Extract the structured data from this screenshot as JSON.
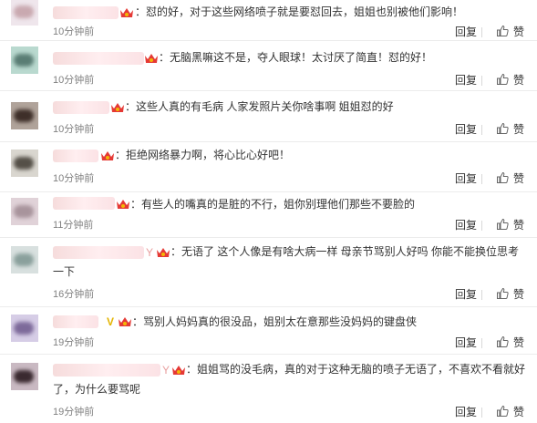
{
  "comments": [
    {
      "name_tail": "",
      "text": "：怼的好，对于这些网络喷子就是要怼回去，姐姐也别被他们影响！",
      "text2": "",
      "time": "10分钟前",
      "reply": "回复",
      "like": "赞"
    },
    {
      "name_tail": "",
      "text": "：无脑黑嘛这不是，夺人眼球！太讨厌了简直！怼的好！",
      "text2": "",
      "time": "10分钟前",
      "reply": "回复",
      "like": "赞"
    },
    {
      "name_tail": "",
      "text": "：这些人真的有毛病 人家发照片关你啥事啊 姐姐怼的好",
      "text2": "",
      "time": "10分钟前",
      "reply": "回复",
      "like": "赞"
    },
    {
      "name_tail": "",
      "text": "：拒绝网络暴力啊，将心比心好吧！",
      "text2": "",
      "time": "10分钟前",
      "reply": "回复",
      "like": "赞"
    },
    {
      "name_tail": "",
      "text": "：有些人的嘴真的是脏的不行，姐你别理他们那些不要脸的",
      "text2": "",
      "time": "11分钟前",
      "reply": "回复",
      "like": "赞"
    },
    {
      "name_tail": "Y",
      "text": "：无语了 这个人像是有啥大病一样 母亲节骂别人好吗 你能不能换位思考",
      "text2": "一下",
      "time": "16分钟前",
      "reply": "回复",
      "like": "赞"
    },
    {
      "name_tail": "V",
      "text": "：骂别人妈妈真的很没品，姐别太在意那些没妈妈的键盘侠",
      "text2": "",
      "time": "19分钟前",
      "reply": "回复",
      "like": "赞"
    },
    {
      "name_tail": "Y",
      "text": "：姐姐骂的没毛病，真的对于这种无脑的喷子无语了，不喜欢不看就好",
      "text2": "了，为什么要骂呢",
      "time": "19分钟前",
      "reply": "回复",
      "like": "赞"
    }
  ],
  "colors": {
    "text": "#333333",
    "time": "#808080",
    "divider": "#ececec",
    "avatars": [
      "#e9dfe6",
      "#b9d9cf",
      "#b0a39a",
      "#d9d6cf",
      "#e0d2d8",
      "#d8e0df",
      "#d6cde6",
      "#c9b9c2"
    ]
  },
  "icons": {
    "crown": "crown-badge-icon",
    "like": "thumbs-up-icon"
  }
}
